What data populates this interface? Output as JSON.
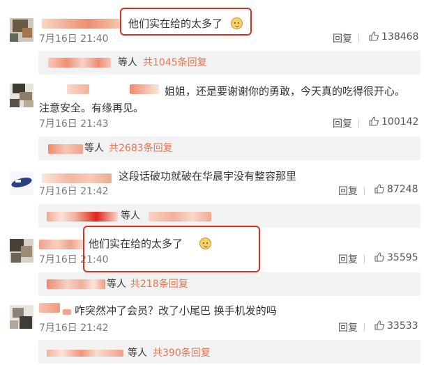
{
  "comments": [
    {
      "text": "他们实在给的太多了",
      "time": "7月16日 21:40",
      "reply": "回复",
      "likes": "138468",
      "sub_more": "等人",
      "sub_count": "共1045条回复"
    },
    {
      "text": "姐姐，还是要谢谢你的勇敢，今天真的吃得很开心。",
      "text2": "注意安全。有缘再见。",
      "time": "7月16日 21:43",
      "reply": "回复",
      "likes": "100142",
      "sub_more": "等人",
      "sub_count": "共2683条回复"
    },
    {
      "text": "这段话破功就破在华晨宇没有整容那里",
      "time": "7月16日 21:42",
      "reply": "回复",
      "likes": "87248",
      "sub_more": "等人",
      "sub_count": ""
    },
    {
      "text": "他们实在给的太多了",
      "time": "7月16日 21:40",
      "reply": "回复",
      "likes": "35595",
      "sub_more": "等人",
      "sub_count": "共218条回复"
    },
    {
      "text": "咋突然冲了会员？改了小尾巴 换手机发的吗",
      "time": "7月16日 21:42",
      "reply": "回复",
      "likes": "33533",
      "sub_more": "等人",
      "sub_count": "共390条回复"
    }
  ],
  "colors": {
    "accent": "#eb7350",
    "highlight": "#e02e1c",
    "sub_bg": "#f2f2f2"
  }
}
